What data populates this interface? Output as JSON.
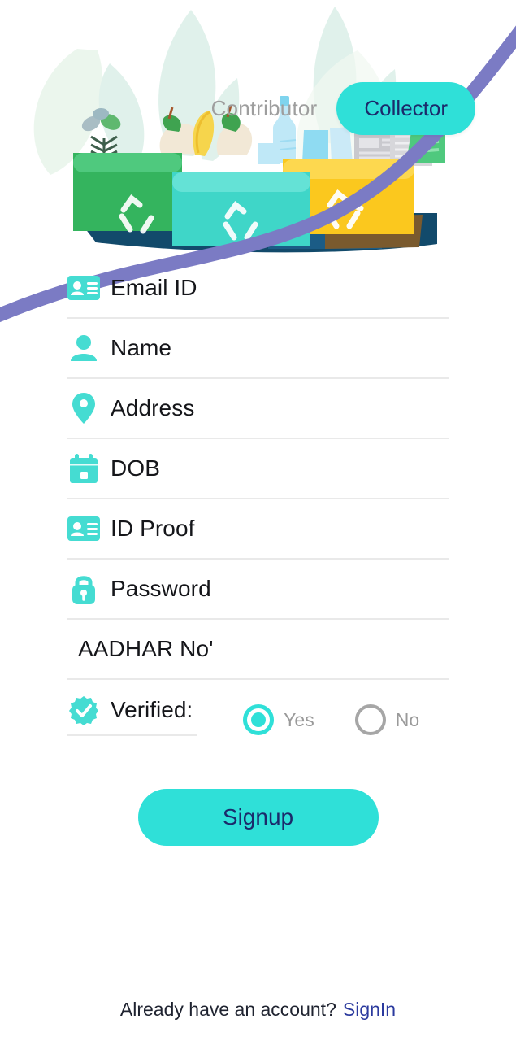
{
  "role_toggle": {
    "inactive_label": "Contributor",
    "active_label": "Collector",
    "active_bg": "#2FE0D8",
    "active_text_color": "#1b2a6b",
    "inactive_text_color": "#9e9e9e"
  },
  "hero": {
    "illustration_name": "recycling-bins-illustration",
    "bins": [
      {
        "name": "organic-bin",
        "color": "#3BBF63"
      },
      {
        "name": "plastic-bin",
        "color": "#3FD6C8"
      },
      {
        "name": "paper-bin",
        "color": "#FBC81E"
      }
    ],
    "leaf_color": "#D6EEDD",
    "swoosh_color": "#7B7BC4",
    "ground_colors": [
      "#124a6b",
      "#1b5c86",
      "#7a5a2e"
    ]
  },
  "form": {
    "fields": [
      {
        "icon": "id-card-icon",
        "label": "Email ID",
        "name": "email-field",
        "value": "",
        "placeholder": "Email ID"
      },
      {
        "icon": "person-icon",
        "label": "Name",
        "name": "name-field",
        "value": "",
        "placeholder": "Name"
      },
      {
        "icon": "location-pin-icon",
        "label": "Address",
        "name": "address-field",
        "value": "",
        "placeholder": "Address"
      },
      {
        "icon": "calendar-icon",
        "label": "DOB",
        "name": "dob-field",
        "value": "",
        "placeholder": "DOB"
      },
      {
        "icon": "id-card-icon",
        "label": "ID Proof",
        "name": "id-proof-field",
        "value": "",
        "placeholder": "ID Proof"
      },
      {
        "icon": "lock-icon",
        "label": "Password",
        "name": "password-field",
        "value": "",
        "placeholder": "Password"
      },
      {
        "icon": "none",
        "label": "AADHAR No'",
        "name": "aadhar-field",
        "value": "",
        "placeholder": "AADHAR No'"
      }
    ],
    "verified": {
      "icon": "verified-badge-icon",
      "label": "Verified:",
      "selected": "Yes",
      "options": [
        {
          "label": "Yes",
          "selected": true
        },
        {
          "label": "No",
          "selected": false
        }
      ]
    }
  },
  "actions": {
    "signup_label": "Signup"
  },
  "footer": {
    "prompt": "Already have an account?",
    "link_label": "SignIn"
  },
  "theme": {
    "teal": "#2FE0D8",
    "icon_teal": "#45DCD2",
    "navy": "#1b2a6b",
    "link_blue": "#2b3a9e",
    "underline": "#e9e9e9",
    "text_dark": "#15161a",
    "text_muted": "#9a9a9a"
  }
}
